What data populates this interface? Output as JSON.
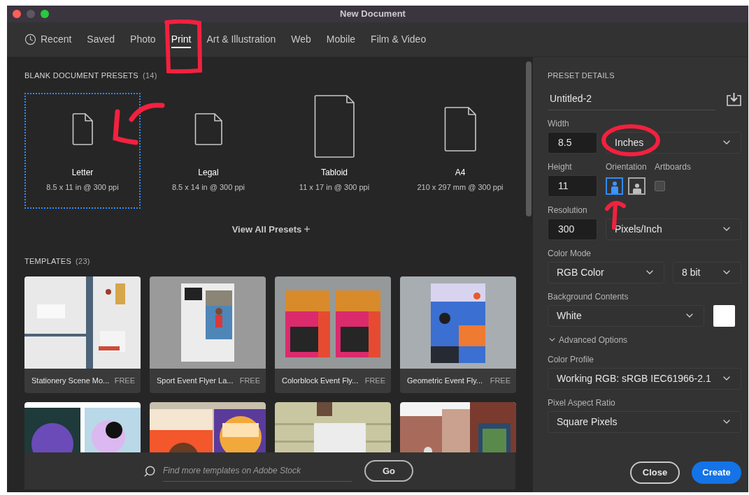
{
  "window": {
    "title": "New Document"
  },
  "tabs": [
    {
      "label": "Recent",
      "kind": "recent",
      "selected": false
    },
    {
      "label": "Saved",
      "kind": "category",
      "selected": false
    },
    {
      "label": "Photo",
      "kind": "category",
      "selected": false
    },
    {
      "label": "Print",
      "kind": "category",
      "selected": true
    },
    {
      "label": "Art & Illustration",
      "kind": "category",
      "selected": false
    },
    {
      "label": "Web",
      "kind": "category",
      "selected": false
    },
    {
      "label": "Mobile",
      "kind": "category",
      "selected": false
    },
    {
      "label": "Film & Video",
      "kind": "category",
      "selected": false
    }
  ],
  "presets": {
    "heading": "BLANK DOCUMENT PRESETS",
    "count": "(14)",
    "items": [
      {
        "name": "Letter",
        "size": "8.5 x 11 in @ 300 ppi",
        "selected": true
      },
      {
        "name": "Legal",
        "size": "8.5 x 14 in @ 300 ppi",
        "selected": false
      },
      {
        "name": "Tabloid",
        "size": "11 x 17 in @ 300 ppi",
        "selected": false
      },
      {
        "name": "A4",
        "size": "210 x 297 mm @ 300 ppi",
        "selected": false
      }
    ],
    "view_all": "View All Presets"
  },
  "templates": {
    "heading": "TEMPLATES",
    "count": "(23)",
    "items": [
      {
        "kind": "template",
        "title": "Stationery Scene Mo...",
        "badge": "FREE"
      },
      {
        "kind": "template",
        "title": "Sport Event Flyer La...",
        "badge": "FREE"
      },
      {
        "kind": "template",
        "title": "Colorblock Event Fly...",
        "badge": "FREE"
      },
      {
        "kind": "template",
        "title": "Geometric Event Fly...",
        "badge": "FREE"
      },
      {
        "kind": "picture"
      },
      {
        "kind": "picture"
      },
      {
        "kind": "picture"
      },
      {
        "kind": "picture"
      }
    ]
  },
  "search": {
    "placeholder": "Find more templates on Adobe Stock",
    "button": "Go"
  },
  "details": {
    "heading": "PRESET DETAILS",
    "name": "Untitled-2",
    "width": {
      "label": "Width",
      "value": "8.5",
      "unit": "Inches"
    },
    "height": {
      "label": "Height",
      "value": "11"
    },
    "orientation": {
      "label": "Orientation",
      "options": [
        {
          "kind": "portrait",
          "selected": true
        },
        {
          "kind": "landscape",
          "selected": false
        }
      ]
    },
    "artboards": {
      "label": "Artboards",
      "checked": false
    },
    "resolution": {
      "label": "Resolution",
      "value": "300",
      "unit": "Pixels/Inch"
    },
    "color_mode": {
      "label": "Color Mode",
      "value": "RGB Color",
      "depth": "8 bit"
    },
    "background": {
      "label": "Background Contents",
      "value": "White"
    },
    "advanced": {
      "label": "Advanced Options",
      "expanded": true
    },
    "color_profile": {
      "label": "Color Profile",
      "value": "Working RGB: sRGB IEC61966-2.1"
    },
    "pixel_aspect": {
      "label": "Pixel Aspect Ratio",
      "value": "Square Pixels"
    }
  },
  "buttons": {
    "close": "Close",
    "create": "Create"
  }
}
